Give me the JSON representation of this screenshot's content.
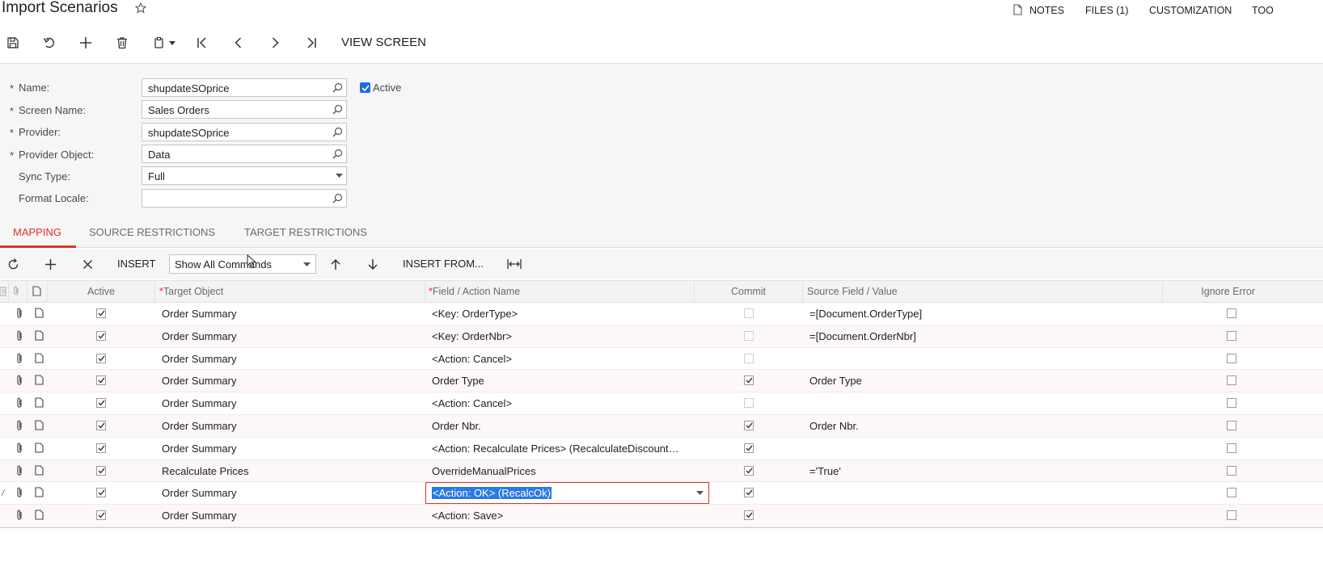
{
  "header": {
    "title": "Import Scenarios",
    "links": {
      "notes": "NOTES",
      "files": "FILES (1)",
      "customization": "CUSTOMIZATION",
      "tools": "TOO"
    }
  },
  "toolbar": {
    "view_screen": "VIEW SCREEN",
    "icons": [
      "save-icon",
      "undo-icon",
      "add-icon",
      "delete-icon",
      "copy-paste-icon",
      "first-record-icon",
      "previous-icon",
      "next-icon",
      "last-record-icon"
    ]
  },
  "form": {
    "name": {
      "label": "Name:",
      "value": "shupdateSOprice"
    },
    "screen_name": {
      "label": "Screen Name:",
      "value": "Sales Orders"
    },
    "provider": {
      "label": "Provider:",
      "value": "shupdateSOprice"
    },
    "provider_object": {
      "label": "Provider Object:",
      "value": "Data"
    },
    "sync_type": {
      "label": "Sync Type:",
      "value": "Full"
    },
    "format_locale": {
      "label": "Format Locale:",
      "value": ""
    },
    "active": {
      "label": "Active",
      "checked": true
    }
  },
  "tabs": {
    "mapping": "MAPPING",
    "source": "SOURCE RESTRICTIONS",
    "target": "TARGET RESTRICTIONS"
  },
  "grid_toolbar": {
    "insert": "INSERT",
    "filter": "Show All Commands",
    "insert_from": "INSERT FROM..."
  },
  "grid": {
    "columns": {
      "active": "Active",
      "target_object": "Target Object",
      "field_action": "Field / Action Name",
      "commit": "Commit",
      "source_field": "Source Field / Value",
      "ignore_error": "Ignore Error"
    },
    "rows": [
      {
        "active": true,
        "target": "Order Summary",
        "field": "<Key: OrderType>",
        "commit": false,
        "commit_dim": true,
        "source": "=[Document.OrderType]",
        "ignore": false
      },
      {
        "active": true,
        "target": "Order Summary",
        "field": "<Key: OrderNbr>",
        "commit": false,
        "commit_dim": true,
        "source": "=[Document.OrderNbr]",
        "ignore": false
      },
      {
        "active": true,
        "target": "Order Summary",
        "field": "<Action: Cancel>",
        "commit": false,
        "commit_dim": true,
        "source": "",
        "ignore": false
      },
      {
        "active": true,
        "target": "Order Summary",
        "field": "Order Type",
        "commit": true,
        "commit_dim": false,
        "source": "Order Type",
        "ignore": false
      },
      {
        "active": true,
        "target": "Order Summary",
        "field": "<Action: Cancel>",
        "commit": false,
        "commit_dim": true,
        "source": "",
        "ignore": false
      },
      {
        "active": true,
        "target": "Order Summary",
        "field": "Order Nbr.",
        "commit": true,
        "commit_dim": false,
        "source": "Order Nbr.",
        "ignore": false
      },
      {
        "active": true,
        "target": "Order Summary",
        "field": "<Action: Recalculate Prices> (RecalculateDiscount…",
        "commit": true,
        "commit_dim": false,
        "source": "",
        "ignore": false
      },
      {
        "active": true,
        "target": "Recalculate Prices",
        "field": "OverrideManualPrices",
        "commit": true,
        "commit_dim": false,
        "source": "='True'",
        "ignore": false
      },
      {
        "active": true,
        "target": "Order Summary",
        "field": "<Action: OK> (RecalcOk)",
        "commit": true,
        "commit_dim": false,
        "source": "",
        "ignore": false,
        "editing": true
      },
      {
        "active": true,
        "target": "Order Summary",
        "field": "<Action: Save>",
        "commit": true,
        "commit_dim": false,
        "source": "",
        "ignore": false
      }
    ]
  }
}
